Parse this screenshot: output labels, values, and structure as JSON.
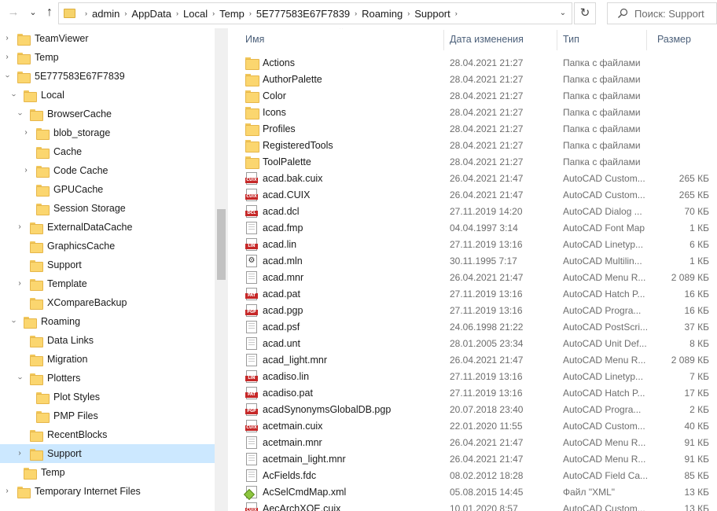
{
  "address": {
    "crumbs": [
      "admin",
      "AppData",
      "Local",
      "Temp",
      "5E777583E67F7839",
      "Roaming",
      "Support"
    ]
  },
  "search": {
    "placeholder": "Поиск: Support"
  },
  "tree": [
    {
      "label": "TeamViewer",
      "chevron": "right",
      "indent": 0
    },
    {
      "label": "Temp",
      "chevron": "right",
      "indent": 0
    },
    {
      "label": "5E777583E67F7839",
      "chevron": "down",
      "indent": 1
    },
    {
      "label": "Local",
      "chevron": "down",
      "indent": 2
    },
    {
      "label": "BrowserCache",
      "chevron": "down",
      "indent": 3
    },
    {
      "label": "blob_storage",
      "chevron": "right",
      "indent": 4
    },
    {
      "label": "Cache",
      "chevron": "none",
      "indent": 4
    },
    {
      "label": "Code Cache",
      "chevron": "right",
      "indent": 4
    },
    {
      "label": "GPUCache",
      "chevron": "none",
      "indent": 4
    },
    {
      "label": "Session Storage",
      "chevron": "none",
      "indent": 4
    },
    {
      "label": "ExternalDataCache",
      "chevron": "right",
      "indent": 3
    },
    {
      "label": "GraphicsCache",
      "chevron": "none",
      "indent": 3
    },
    {
      "label": "Support",
      "chevron": "none",
      "indent": 3
    },
    {
      "label": "Template",
      "chevron": "right",
      "indent": 3
    },
    {
      "label": "XCompareBackup",
      "chevron": "none",
      "indent": 3
    },
    {
      "label": "Roaming",
      "chevron": "down",
      "indent": 2
    },
    {
      "label": "Data Links",
      "chevron": "none",
      "indent": 3
    },
    {
      "label": "Migration",
      "chevron": "none",
      "indent": 3
    },
    {
      "label": "Plotters",
      "chevron": "down",
      "indent": 3
    },
    {
      "label": "Plot Styles",
      "chevron": "none",
      "indent": 4
    },
    {
      "label": "PMP Files",
      "chevron": "none",
      "indent": 4
    },
    {
      "label": "RecentBlocks",
      "chevron": "none",
      "indent": 3
    },
    {
      "label": "Support",
      "chevron": "right",
      "indent": 3,
      "selected": true
    },
    {
      "label": "Temp",
      "chevron": "none",
      "indent": 2
    },
    {
      "label": "Temporary Internet Files",
      "chevron": "right",
      "indent": 0
    }
  ],
  "columns": {
    "name": "Имя",
    "date": "Дата изменения",
    "type": "Тип",
    "size": "Размер"
  },
  "files": [
    {
      "name": "Actions",
      "date": "28.04.2021 21:27",
      "type": "Папка с файлами",
      "size": "",
      "icon": "folder-icon"
    },
    {
      "name": "AuthorPalette",
      "date": "28.04.2021 21:27",
      "type": "Папка с файлами",
      "size": "",
      "icon": "folder-icon"
    },
    {
      "name": "Color",
      "date": "28.04.2021 21:27",
      "type": "Папка с файлами",
      "size": "",
      "icon": "folder-icon"
    },
    {
      "name": "Icons",
      "date": "28.04.2021 21:27",
      "type": "Папка с файлами",
      "size": "",
      "icon": "folder-icon"
    },
    {
      "name": "Profiles",
      "date": "28.04.2021 21:27",
      "type": "Папка с файлами",
      "size": "",
      "icon": "folder-icon"
    },
    {
      "name": "RegisteredTools",
      "date": "28.04.2021 21:27",
      "type": "Папка с файлами",
      "size": "",
      "icon": "folder-icon"
    },
    {
      "name": "ToolPalette",
      "date": "28.04.2021 21:27",
      "type": "Папка с файлами",
      "size": "",
      "icon": "folder-icon"
    },
    {
      "name": "acad.bak.cuix",
      "date": "26.04.2021 21:47",
      "type": "AutoCAD Custom...",
      "size": "265 КБ",
      "icon": "cuix-file-icon",
      "tag": "CUIX"
    },
    {
      "name": "acad.CUIX",
      "date": "26.04.2021 21:47",
      "type": "AutoCAD Custom...",
      "size": "265 КБ",
      "icon": "cuix-file-icon",
      "tag": "CUIX"
    },
    {
      "name": "acad.dcl",
      "date": "27.11.2019 14:20",
      "type": "AutoCAD Dialog ...",
      "size": "70 КБ",
      "icon": "dcl-file-icon",
      "tag": "DCL"
    },
    {
      "name": "acad.fmp",
      "date": "04.04.1997 3:14",
      "type": "AutoCAD Font Map",
      "size": "1 КБ",
      "icon": "document-icon"
    },
    {
      "name": "acad.lin",
      "date": "27.11.2019 13:16",
      "type": "AutoCAD Linetyp...",
      "size": "6 КБ",
      "icon": "lin-file-icon",
      "tag": "LIN"
    },
    {
      "name": "acad.mln",
      "date": "30.11.1995 7:17",
      "type": "AutoCAD Multilin...",
      "size": "1 КБ",
      "icon": "gear-file-icon"
    },
    {
      "name": "acad.mnr",
      "date": "26.04.2021 21:47",
      "type": "AutoCAD Menu R...",
      "size": "2 089 КБ",
      "icon": "document-icon"
    },
    {
      "name": "acad.pat",
      "date": "27.11.2019 13:16",
      "type": "AutoCAD Hatch P...",
      "size": "16 КБ",
      "icon": "pat-file-icon",
      "tag": "PAT"
    },
    {
      "name": "acad.pgp",
      "date": "27.11.2019 13:16",
      "type": "AutoCAD Progra...",
      "size": "16 КБ",
      "icon": "pgp-file-icon",
      "tag": "PGP"
    },
    {
      "name": "acad.psf",
      "date": "24.06.1998 21:22",
      "type": "AutoCAD PostScri...",
      "size": "37 КБ",
      "icon": "document-icon"
    },
    {
      "name": "acad.unt",
      "date": "28.01.2005 23:34",
      "type": "AutoCAD Unit Def...",
      "size": "8 КБ",
      "icon": "document-icon"
    },
    {
      "name": "acad_light.mnr",
      "date": "26.04.2021 21:47",
      "type": "AutoCAD Menu R...",
      "size": "2 089 КБ",
      "icon": "document-icon"
    },
    {
      "name": "acadiso.lin",
      "date": "27.11.2019 13:16",
      "type": "AutoCAD Linetyp...",
      "size": "7 КБ",
      "icon": "lin-file-icon",
      "tag": "LIN"
    },
    {
      "name": "acadiso.pat",
      "date": "27.11.2019 13:16",
      "type": "AutoCAD Hatch P...",
      "size": "17 КБ",
      "icon": "pat-file-icon",
      "tag": "PAT"
    },
    {
      "name": "acadSynonymsGlobalDB.pgp",
      "date": "20.07.2018 23:40",
      "type": "AutoCAD Progra...",
      "size": "2 КБ",
      "icon": "pgp-file-icon",
      "tag": "PGP"
    },
    {
      "name": "acetmain.cuix",
      "date": "22.01.2020 11:55",
      "type": "AutoCAD Custom...",
      "size": "40 КБ",
      "icon": "cuix-file-icon",
      "tag": "CUIX"
    },
    {
      "name": "acetmain.mnr",
      "date": "26.04.2021 21:47",
      "type": "AutoCAD Menu R...",
      "size": "91 КБ",
      "icon": "document-icon"
    },
    {
      "name": "acetmain_light.mnr",
      "date": "26.04.2021 21:47",
      "type": "AutoCAD Menu R...",
      "size": "91 КБ",
      "icon": "document-icon"
    },
    {
      "name": "AcFields.fdc",
      "date": "08.02.2012 18:28",
      "type": "AutoCAD Field Ca...",
      "size": "85 КБ",
      "icon": "document-icon"
    },
    {
      "name": "AcSelCmdMap.xml",
      "date": "05.08.2015 14:45",
      "type": "Файл \"XML\"",
      "size": "13 КБ",
      "icon": "xml-file-icon"
    },
    {
      "name": "AecArchXOE.cuix",
      "date": "10.01.2020 8:57",
      "type": "AutoCAD Custom...",
      "size": "13 КБ",
      "icon": "cuix-file-icon",
      "tag": "CUIX"
    }
  ]
}
